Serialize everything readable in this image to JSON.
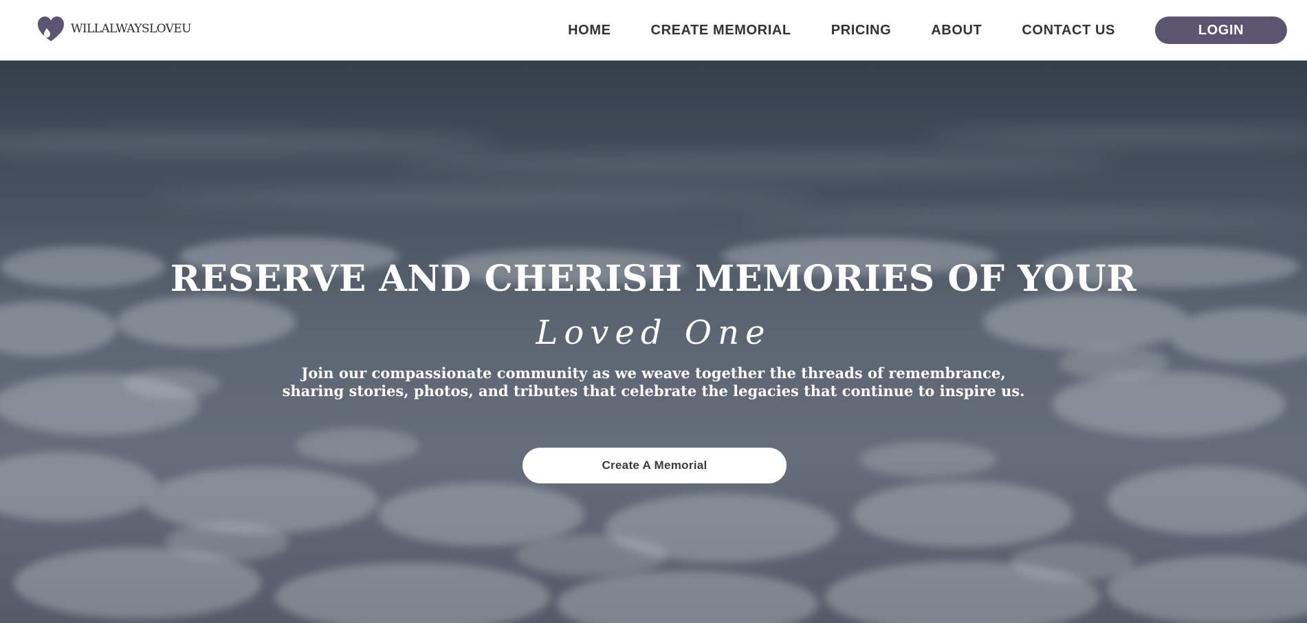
{
  "brand": {
    "name": "WILLALWAYSLOVEU",
    "logo_icon": "heart-teardrop-icon",
    "logo_color": "#5c5572"
  },
  "nav": {
    "items": [
      {
        "label": "HOME"
      },
      {
        "label": "CREATE MEMORIAL"
      },
      {
        "label": "PRICING"
      },
      {
        "label": "ABOUT"
      },
      {
        "label": "CONTACT US"
      }
    ],
    "login_label": "LOGIN"
  },
  "hero": {
    "title": "RESERVE AND CHERISH MEMORIES OF YOUR",
    "script": "Loved One",
    "subtitle": "Join our compassionate community as we weave together the threads of remembrance, sharing stories, photos, and tributes that celebrate the legacies that continue to inspire us.",
    "cta_label": "Create A Memorial",
    "background": "sky-above-clouds-image"
  },
  "colors": {
    "accent": "#5c5572",
    "header_bg": "#ffffff",
    "nav_text": "#333333",
    "hero_text": "#ffffff",
    "cta_bg": "#ffffff",
    "cta_text": "#3a3a3a"
  }
}
